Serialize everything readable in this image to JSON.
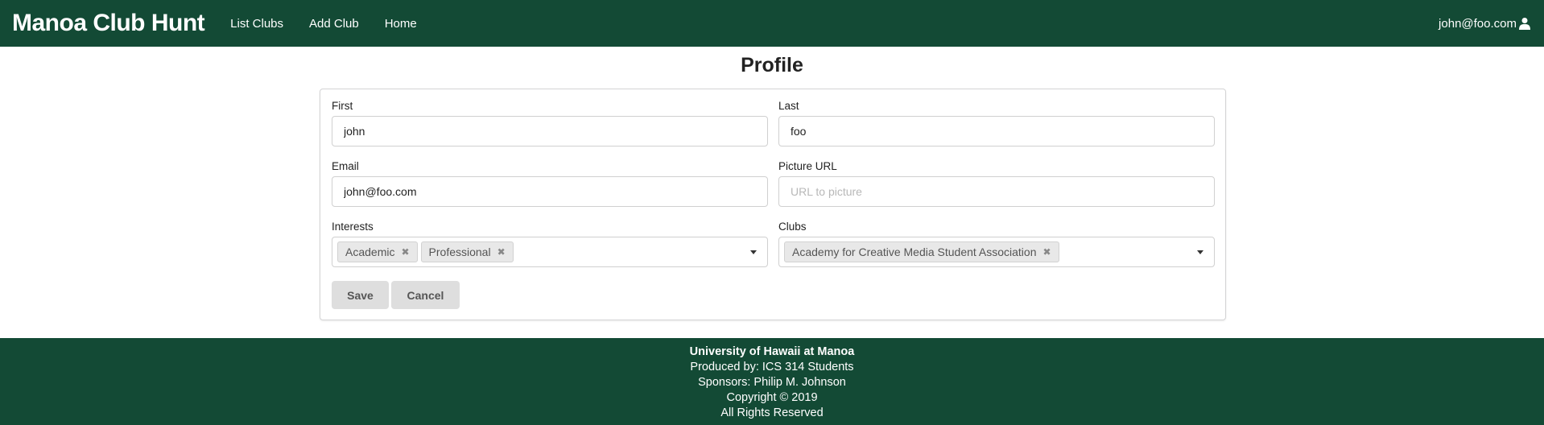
{
  "navbar": {
    "brand": "Manoa Club Hunt",
    "links": [
      "List Clubs",
      "Add Club",
      "Home"
    ],
    "user": "john@foo.com",
    "user_icon": "user-icon"
  },
  "page": {
    "title": "Profile"
  },
  "form": {
    "first": {
      "label": "First",
      "value": "john"
    },
    "last": {
      "label": "Last",
      "value": "foo"
    },
    "email": {
      "label": "Email",
      "value": "john@foo.com"
    },
    "picture": {
      "label": "Picture URL",
      "value": "",
      "placeholder": "URL to picture"
    },
    "interests": {
      "label": "Interests",
      "tags": [
        "Academic",
        "Professional"
      ]
    },
    "clubs": {
      "label": "Clubs",
      "tags": [
        "Academy for Creative Media Student Association"
      ]
    },
    "save_label": "Save",
    "cancel_label": "Cancel"
  },
  "footer": {
    "lines": [
      "University of Hawaii at Manoa",
      "Produced by: ICS 314 Students",
      "Sponsors: Philip M. Johnson",
      "Copyright © 2019",
      "All Rights Reserved"
    ]
  },
  "colors": {
    "brand_green": "#134a35",
    "button_gray": "#dedede"
  }
}
